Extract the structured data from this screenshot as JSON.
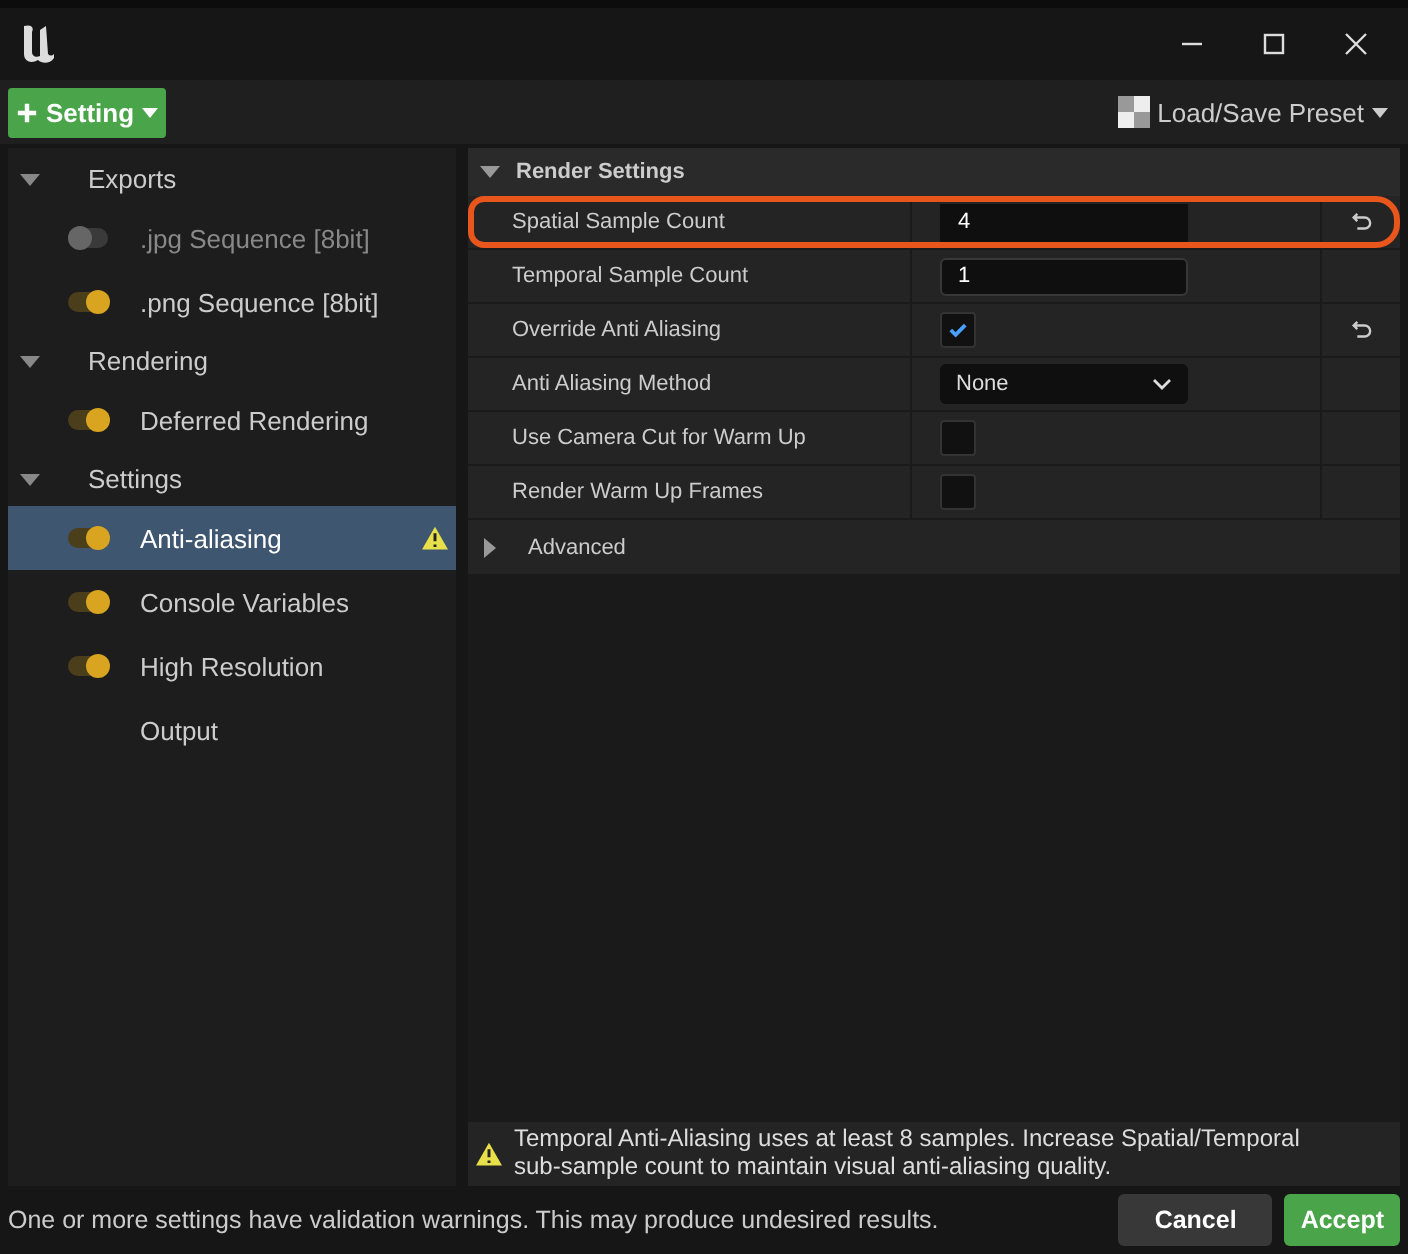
{
  "toolbar": {
    "add_button": "Setting",
    "preset_button": "Load/Save Preset"
  },
  "sidebar": {
    "items": [
      {
        "label": "Exports",
        "expanded": true,
        "children": [
          {
            "kind": "setting",
            "label": ".jpg Sequence [8bit]",
            "enabled": false,
            "selected": false,
            "warning": false
          },
          {
            "kind": "setting",
            "label": ".png Sequence [8bit]",
            "enabled": true,
            "selected": false,
            "warning": false
          }
        ]
      },
      {
        "label": "Rendering",
        "expanded": true,
        "children": [
          {
            "kind": "setting",
            "label": "Deferred Rendering",
            "enabled": true,
            "selected": false,
            "warning": false
          }
        ]
      },
      {
        "label": "Settings",
        "expanded": true,
        "children": [
          {
            "kind": "setting",
            "label": "Anti-aliasing",
            "enabled": true,
            "selected": true,
            "warning": true
          },
          {
            "kind": "setting",
            "label": "Console Variables",
            "enabled": true,
            "selected": false,
            "warning": false
          },
          {
            "kind": "setting",
            "label": "High Resolution",
            "enabled": true,
            "selected": false,
            "warning": false
          },
          {
            "kind": "plain",
            "label": "Output",
            "selected": false
          }
        ]
      }
    ]
  },
  "details": {
    "section": "Render Settings",
    "expanded": true,
    "rows": [
      {
        "kind": "number",
        "label": "Spatial Sample Count",
        "value": "4",
        "focused": true,
        "highlighted": true,
        "reset": true
      },
      {
        "kind": "number",
        "label": "Temporal Sample Count",
        "value": "1",
        "focused": false,
        "highlighted": false,
        "reset": false
      },
      {
        "kind": "checkbox",
        "label": "Override Anti Aliasing",
        "checked": true,
        "highlighted": false,
        "reset": true
      },
      {
        "kind": "dropdown",
        "label": "Anti Aliasing Method",
        "value": "None",
        "highlighted": false,
        "reset": false
      },
      {
        "kind": "checkbox",
        "label": "Use Camera Cut for Warm Up",
        "checked": false,
        "highlighted": false,
        "reset": false
      },
      {
        "kind": "checkbox",
        "label": "Render Warm Up Frames",
        "checked": false,
        "highlighted": false,
        "reset": false
      }
    ],
    "advanced": {
      "label": "Advanced",
      "expanded": false
    }
  },
  "warning": "Temporal Anti-Aliasing uses at least 8 samples. Increase Spatial/Temporal sub-sample count to maintain visual anti-aliasing quality.",
  "status": "One or more settings have validation warnings. This may produce undesired results.",
  "buttons": [
    {
      "kind": "cancel",
      "label": "Cancel"
    },
    {
      "kind": "accept",
      "label": "Accept"
    }
  ]
}
